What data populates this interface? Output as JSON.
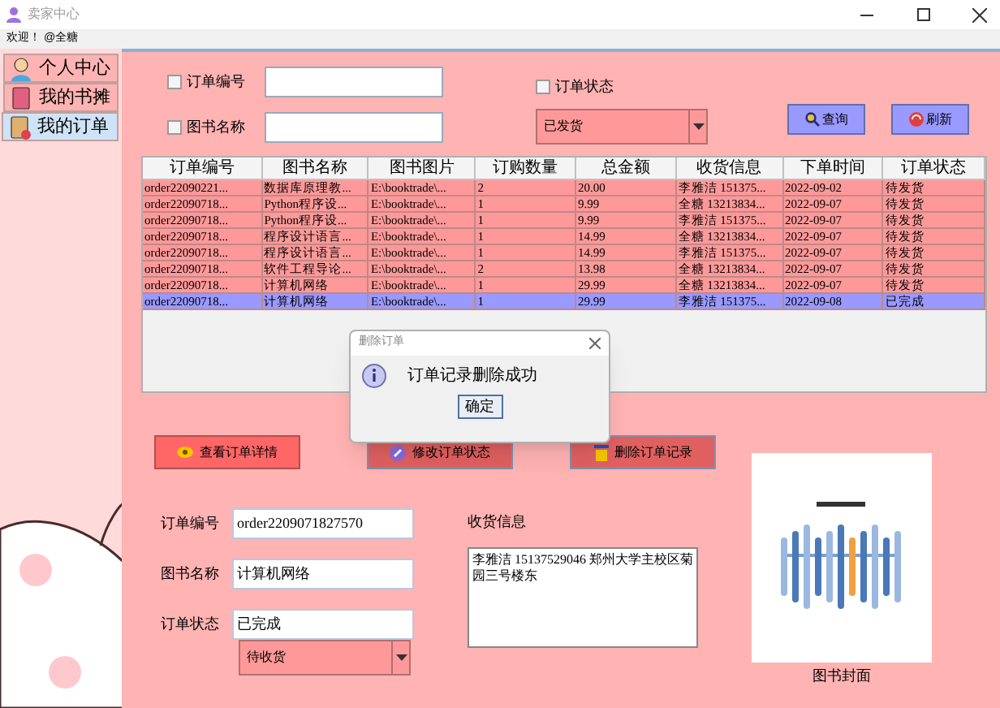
{
  "window": {
    "title": "卖家中心"
  },
  "welcome": {
    "label": "欢迎！",
    "user": "@全糖"
  },
  "tabs": [
    {
      "label": "个人中心",
      "selected": false
    },
    {
      "label": "我的书摊",
      "selected": false
    },
    {
      "label": "我的订单",
      "selected": true
    }
  ],
  "filters": {
    "order_no": {
      "label": "订单编号",
      "checked": false
    },
    "book_name": {
      "label": "图书名称",
      "checked": false
    },
    "status": {
      "label": "订单状态",
      "checked": false,
      "value": "已发货"
    },
    "buttons": [
      "查询",
      "刷新"
    ]
  },
  "table": {
    "columns": [
      "订单编号",
      "图书名称",
      "图书图片",
      "订购数量",
      "总金额",
      "收货信息",
      "下单时间",
      "订单状态"
    ],
    "rows": [
      {
        "cells": [
          "order22090221...",
          "数据库原理教...",
          "E:\\booktrade\\...",
          "2",
          "20.00",
          "李雅洁 151375...",
          "2022-09-02",
          "待发货"
        ],
        "selected": false
      },
      {
        "cells": [
          "order22090718...",
          "Python程序设...",
          "E:\\booktrade\\...",
          "1",
          "9.99",
          "全糖 13213834...",
          "2022-09-07",
          "待发货"
        ],
        "selected": false
      },
      {
        "cells": [
          "order22090718...",
          "Python程序设...",
          "E:\\booktrade\\...",
          "1",
          "9.99",
          "李雅洁 151375...",
          "2022-09-07",
          "待发货"
        ],
        "selected": false
      },
      {
        "cells": [
          "order22090718...",
          "程序设计语言...",
          "E:\\booktrade\\...",
          "1",
          "14.99",
          "全糖 13213834...",
          "2022-09-07",
          "待发货"
        ],
        "selected": false
      },
      {
        "cells": [
          "order22090718...",
          "程序设计语言...",
          "E:\\booktrade\\...",
          "1",
          "14.99",
          "李雅洁 151375...",
          "2022-09-07",
          "待发货"
        ],
        "selected": false
      },
      {
        "cells": [
          "order22090718...",
          "软件工程导论...",
          "E:\\booktrade\\...",
          "2",
          "13.98",
          "全糖 13213834...",
          "2022-09-07",
          "待发货"
        ],
        "selected": false
      },
      {
        "cells": [
          "order22090718...",
          "计算机网络",
          "E:\\booktrade\\...",
          "1",
          "29.99",
          "全糖 13213834...",
          "2022-09-07",
          "待发货"
        ],
        "selected": false
      },
      {
        "cells": [
          "order22090718...",
          "计算机网络",
          "E:\\booktrade\\...",
          "1",
          "29.99",
          "李雅洁 151375...",
          "2022-09-08",
          "已完成"
        ],
        "selected": true
      }
    ]
  },
  "actions": [
    "查看订单详情",
    "修改订单状态",
    "删除订单记录"
  ],
  "detail": {
    "order_no": {
      "label": "订单编号",
      "value": "order2209071827570"
    },
    "book_name": {
      "label": "图书名称",
      "value": "计算机网络"
    },
    "status": {
      "label": "订单状态",
      "value": "已完成"
    },
    "new_status": "待收货",
    "address": {
      "label": "收货信息",
      "value": "李雅洁 15137529046 郑州大学主校区菊园三号楼东"
    },
    "cover_caption": "图书封面"
  },
  "dialog": {
    "title": "删除订单",
    "message": "订单记录删除成功",
    "button": "确定"
  }
}
